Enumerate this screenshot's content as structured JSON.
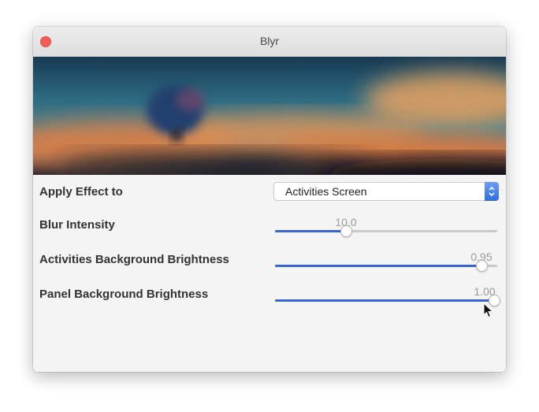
{
  "window": {
    "title": "Blyr"
  },
  "settings": {
    "apply_effect": {
      "label": "Apply Effect to",
      "selected": "Activities Screen"
    },
    "blur_intensity": {
      "label": "Blur Intensity",
      "value": "10.0",
      "fraction": 0.32
    },
    "activities_brightness": {
      "label": "Activities Background Brightness",
      "value": "0.95",
      "fraction": 0.93
    },
    "panel_brightness": {
      "label": "Panel Background Brightness",
      "value": "1.00",
      "fraction": 0.985
    }
  },
  "icons": {
    "close": "close-icon",
    "select_arrows": "up-down-arrows-icon",
    "cursor": "mouse-pointer-icon"
  },
  "colors": {
    "accent": "#3a64d4",
    "close": "#f25c54"
  }
}
